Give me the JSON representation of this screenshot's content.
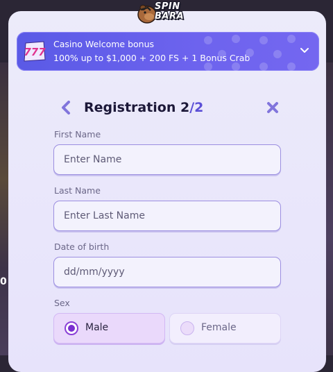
{
  "background": {
    "edge_text": "0"
  },
  "brand": {
    "logo_text_line1": "SPIN",
    "logo_text_line2": "BARA"
  },
  "bonus": {
    "title": "Casino Welcome bonus",
    "offer": "100% up to $1,000 + 200 FS + 1 Bonus Crab",
    "badge_text": "777",
    "expand_icon": "chevron-down-icon"
  },
  "registration": {
    "title": "Registration 2",
    "step_of": "/2",
    "back_icon": "chevron-left-icon",
    "close_icon": "close-icon",
    "fields": {
      "first_name": {
        "label": "First Name",
        "placeholder": "Enter Name",
        "value": ""
      },
      "last_name": {
        "label": "Last Name",
        "placeholder": "Enter Last Name",
        "value": ""
      },
      "dob": {
        "label": "Date of birth",
        "placeholder": "dd/mm/yyyy",
        "value": ""
      }
    },
    "sex": {
      "label": "Sex",
      "options": [
        {
          "label": "Male",
          "selected": true
        },
        {
          "label": "Female",
          "selected": false
        }
      ]
    }
  },
  "colors": {
    "accent": "#5b4fd6",
    "banner": "#6a60ec",
    "modal_bg": "#ebe9fb",
    "radio_selected": "#7a2fd0"
  }
}
